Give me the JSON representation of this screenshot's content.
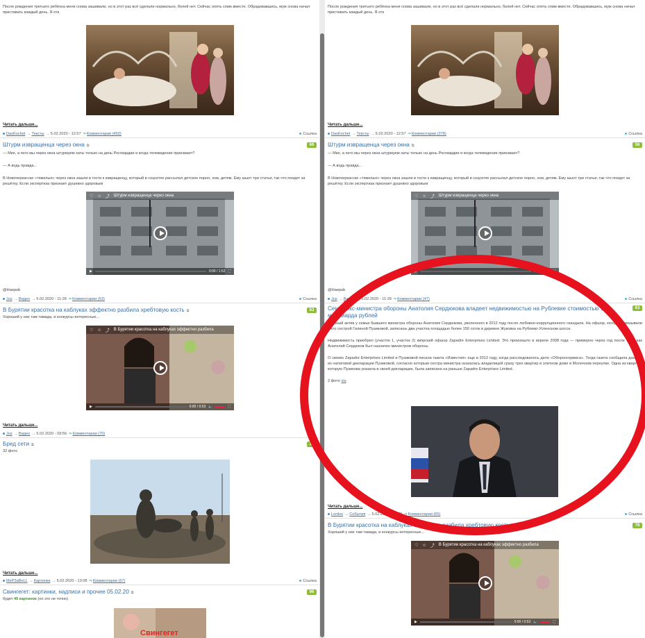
{
  "left": {
    "post1": {
      "intro": "После рождения третьего ребёнка меня снова зашивали, но в этот раз всё сделали нормально, болей нет. Сейчас опять спим вместе. Обрадовавшись, муж снова начал приставать каждый день. Я отк",
      "read_more": "Читать дальше...",
      "author": "DasKochet",
      "category": "Тексты",
      "date": "5.02.2020 - 12:57",
      "comments": "Комментарии (450)",
      "link_label": "Ссылка"
    },
    "post2": {
      "title": "Штурм извращенца через окна",
      "score": "66",
      "p1": "— Мих, а чего мы через окна штурмуем хаты только на день Росгвардии и когда телевидение приезжает?",
      "p2": "— А водь правда...",
      "p3": "В Новочеркасске «тяжелые» через окна зашли в гости к извращенцу, который в соцсетях рассылал детское порно, ххм, детям. Ему шьют три статьи, так что поедет за решётку. Если экспертиза признает душевно здоровым",
      "video_title": "Штурм извращенца через окна",
      "video_time": "0:00 / 1:52",
      "source": "@Haepub",
      "author": "Jus",
      "category": "Видео",
      "date": "5.02.2020 - 11:28",
      "comments": "Комментарии (53)",
      "link_label": "Ссылка"
    },
    "post3": {
      "title": "В Бурятии красотка на каблуках эффектно разбила хребтовую кость",
      "score": "63",
      "subtitle": "Хороший у них там тамада, и конкурсы интересные...",
      "video_title": "В Бурятии красотка на каблуках эффектно разбила",
      "video_time": "0:00 / 0:53",
      "read_more": "Читать дальше...",
      "author": "Jus",
      "category": "Видео",
      "date": "5.02.2020 - 09:56",
      "comments": "Комментарии (70)"
    },
    "post4": {
      "title": "Бред сети",
      "score": "17",
      "subtitle": "32 фото",
      "read_more": "Читать дальше...",
      "author": "MeP3aBeLL",
      "category": "Картинки",
      "date": "5.02.2020 - 13:08",
      "comments": "Комментарии (67)",
      "link_label": "Ссылка"
    },
    "post5": {
      "title": "Свингегет: картинки, надписи и прочее 05.02.20",
      "score": "96",
      "sub_prefix": "будет",
      "sub_count": "45 картинок",
      "sub_suffix": "(но это не точно)",
      "image_caption": "Свингегет"
    }
  },
  "right": {
    "post1": {
      "intro": "После рождения третьего ребёнка меня снова зашивали, но в этот раз всё сделали нормально, болей нет. Сейчас опять спим вместе. Обрадовавшись, муж снова начал приставать каждый день. Я отк",
      "read_more": "Читать дальше...",
      "author": "DasKochet",
      "category": "Тексты",
      "date": "5.02.2020 - 12:57",
      "comments": "Комментарии (378)",
      "link_label": "Ссылка"
    },
    "post2": {
      "title": "Штурм извращенца через окна",
      "score": "56",
      "p1": "— Мих, а чего мы через окна штурмуем хаты только на день Росгвардии и когда телевидение приезжает?",
      "p2": "— А водь правда...",
      "p3": "В Новочеркасске «тяжелые» через окна зашли в гости к извращенцу, который в соцсетях рассылал детское порно, ххм, детям. Ему шьют три статьи, так что поедет за решётку. Если экспертиза признает душевно здоровым",
      "video_title": "Штурм извращенца через окна",
      "video_time": "0:00 / 1:52",
      "source": "@Haepub",
      "author": "Jus",
      "category": "Видео",
      "date": "5.02.2020 - 11:28",
      "comments": "Комментарии (47)",
      "link_label": "Ссылка"
    },
    "post3": {
      "title": "Семья экс-министра обороны Анатолия Сердюкова владеет недвижимостью на Рублевке стоимостью 1,7 миллиарда рублей",
      "score": "63",
      "p1": "Крупный актив у семьи бывшего министра обороны Анатолия Сердюкова, уволенного в 2012 году после любовно-коррупционного скандала. На офшор, который связывали с его сестрой Галиной Пузиковой, записаны два участка площадью более 150 соток в деревне Жуковка на Рублево-Успенском шоссе.",
      "p2": "Недвижимость приобрел (участок 1, участок 2) кипрский офшор Zapadre Enterprises Limited. Это произошло в апреле 2008 года — примерно через год после того, как Анатолий Сердюков был назначен министром обороны.",
      "p3": "О связях Zapadre Enterprises Limited и Пузиковой писала газета «Известия» еще в 2012 году, когда расследовалось дело «Оборонсервиса». Тогда газета сообщила данные из налоговой декларации Пузиковой, согласно которым сестра министра оказалась владелицей сразу трех квартир в элитном доме в Молочном переулке. Одна из квартир, которую Пузикова указала в своей декларации, была записана на раньше Zapadre Enterprises Limited.",
      "photos": "2 фото",
      "photos_link": "via",
      "read_more": "Читать дальше...",
      "author": "Lordox",
      "category": "События",
      "date": "5.02.2020 - 10:56",
      "comments": "Комментарии (65)",
      "link_label": "Ссылка"
    },
    "post4": {
      "title": "В Бурятии красотка на каблуках эффектно разбила хребтовую кость",
      "score": "78",
      "subtitle": "Хороший у них там тамада, и конкурсы интересные...",
      "video_title": "В Бурятии красотка на каблуках эффектно разбила",
      "video_time": "0:00 / 0:53"
    }
  },
  "colors": {
    "link": "#3a6fa6",
    "score_badge": "#8dbd3a",
    "annotation_ring": "#e6121e"
  },
  "icons": [
    "heart-icon",
    "star-icon",
    "share-icon",
    "play-icon",
    "volume-icon",
    "fullscreen-icon",
    "external-link-icon",
    "user-icon",
    "link-icon"
  ]
}
